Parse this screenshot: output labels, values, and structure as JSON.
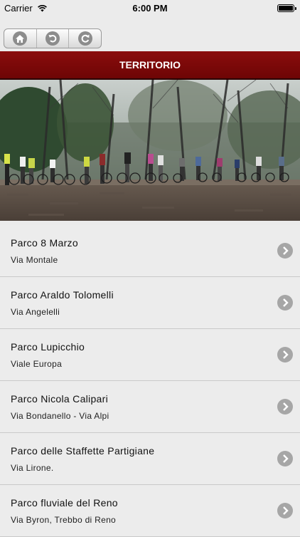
{
  "status_bar": {
    "carrier": "Carrier",
    "time": "6:00 PM"
  },
  "toolbar": {
    "buttons": [
      "home-icon",
      "back-icon",
      "refresh-icon"
    ]
  },
  "header": {
    "title": "TERRITORIO"
  },
  "parks": [
    {
      "name": "Parco 8 Marzo",
      "address": "Via Montale"
    },
    {
      "name": "Parco Araldo Tolomelli",
      "address": "Via Angelelli"
    },
    {
      "name": "Parco Lupicchio",
      "address": "Viale Europa"
    },
    {
      "name": "Parco Nicola Calipari",
      "address": "Via Bondanello - Via Alpi"
    },
    {
      "name": "Parco delle Staffette Partigiane",
      "address": "Via Lirone."
    },
    {
      "name": "Parco fluviale del Reno",
      "address": "Via Byron, Trebbo di Reno"
    }
  ],
  "colors": {
    "header": "#7d0909",
    "background": "#ebebeb"
  }
}
